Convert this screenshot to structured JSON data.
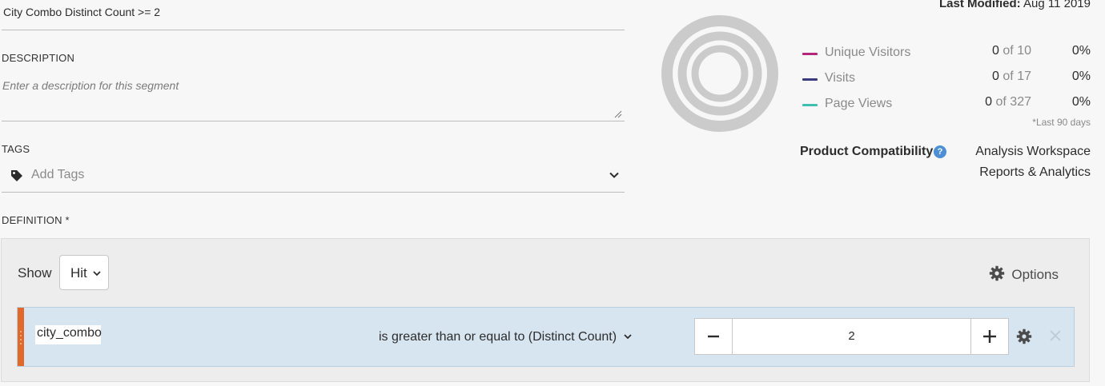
{
  "segment": {
    "title": "City Combo Distinct Count >= 2",
    "description_label": "DESCRIPTION",
    "description_placeholder": "Enter a description for this segment",
    "tags_label": "TAGS",
    "tags_placeholder": "Add Tags",
    "definition_label": "DEFINITION *"
  },
  "summary": {
    "last_modified_label": "Last Modified:",
    "last_modified_value": "Aug 11 2019",
    "metrics": [
      {
        "name": "Unique Visitors",
        "count": "0",
        "of": "of 10",
        "pct": "0%",
        "color": "#b5267b"
      },
      {
        "name": "Visits",
        "count": "0",
        "of": "of 17",
        "pct": "0%",
        "color": "#3a3a7e"
      },
      {
        "name": "Page Views",
        "count": "0",
        "of": "of 327",
        "pct": "0%",
        "color": "#3fbfb0"
      }
    ],
    "period_note": "*Last 90 days",
    "compat_label": "Product Compatibility",
    "compat_items": [
      "Analysis Workspace",
      "Reports & Analytics"
    ]
  },
  "definition": {
    "show_label": "Show",
    "show_value": "Hit",
    "options_label": "Options",
    "rule": {
      "dimension": "city_combo",
      "operator": "is greater than or equal to (Distinct Count)",
      "value": "2"
    }
  },
  "icons": {
    "tag": "tag-icon",
    "chevron": "chevron-down-icon",
    "help": "help-icon",
    "gear": "gear-icon",
    "minus": "minus-icon",
    "plus": "plus-icon",
    "close": "close-icon"
  },
  "colors": {
    "accent_handle": "#e0692b",
    "rule_background": "#d7e5f0",
    "help_blue": "#4b8fd9"
  }
}
